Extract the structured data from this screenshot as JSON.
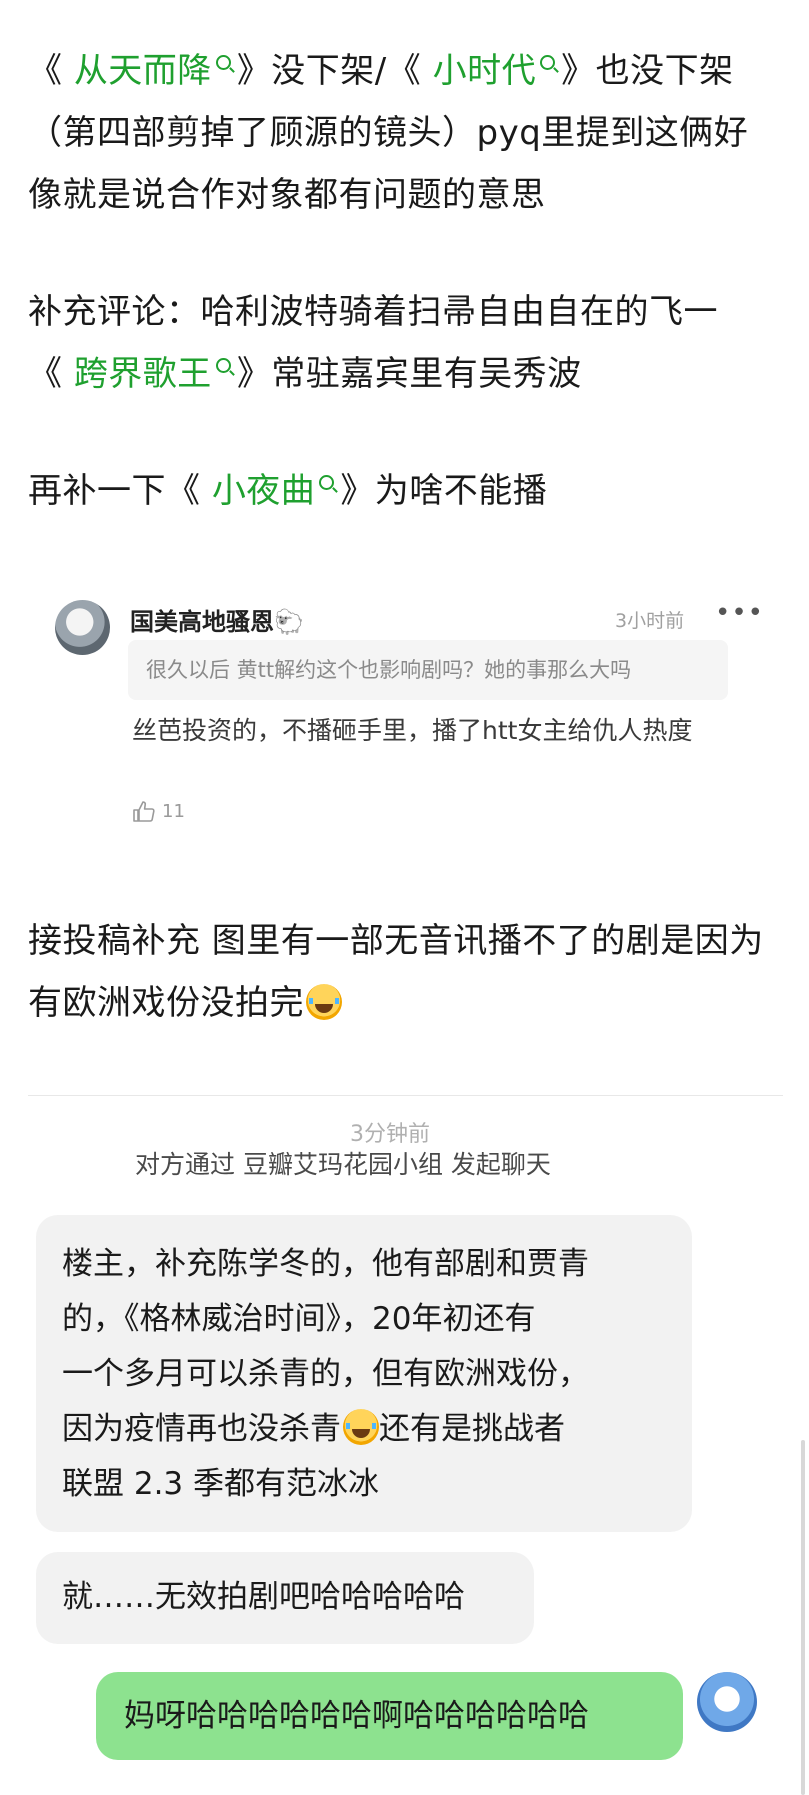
{
  "post": {
    "l1": {
      "open1": "《 ",
      "link1": "从天而降",
      "mid1": "》没下架/《 ",
      "link2": "小时代",
      "end1": "》也没下架"
    },
    "l2": "（第四部剪掉了顾源的镜头）pyq里提到这俩好",
    "l3": "像就是说合作对象都有问题的意思",
    "l4": "补充评论：哈利波特骑着扫帚自由自在的飞一",
    "l5": {
      "open": "《 ",
      "link": "跨界歌王",
      "end": "》常驻嘉宾里有吴秀波"
    },
    "l6": {
      "pre": "再补一下《 ",
      "link": "小夜曲",
      "end": "》为啥不能播"
    }
  },
  "comment": {
    "author": "国美高地骚恩🐑",
    "time": "3小时前",
    "more": "•••",
    "quote": "很久以后 黄tt解约这个也影响剧吗？她的事那么大吗",
    "reply": "丝芭投资的，不播砸手里，播了htt女主给仇人热度",
    "likes": "11"
  },
  "post2": {
    "l1": "接投稿补充 图里有一部无音讯播不了的剧是因为",
    "l2": "有欧洲戏份没拍完"
  },
  "chat": {
    "time": "3分钟前",
    "system": "对方通过 豆瓣艾玛花园小组 发起聊天",
    "m1": {
      "l1": "楼主，补充陈学冬的，他有部剧和贾青",
      "l2": "的，《格林威治时间》，20年初还有",
      "l3": "一个多月可以杀青的，但有欧洲戏份，",
      "l4a": "因为疫情再也没杀青",
      "l4b": "还有是挑战者",
      "l5": "联盟 2.3 季都有范冰冰"
    },
    "m2": "就……无效拍剧吧哈哈哈哈哈",
    "m3": "妈呀哈哈哈哈哈哈啊哈哈哈哈哈哈"
  },
  "icons": {
    "search": "magnifier-icon",
    "emoji": "laughing-tears-emoji-icon",
    "like": "thumbs-up-icon"
  },
  "colors": {
    "link": "#1fa02f",
    "my_bubble": "#8de28f",
    "other_bubble": "#f2f2f2"
  }
}
